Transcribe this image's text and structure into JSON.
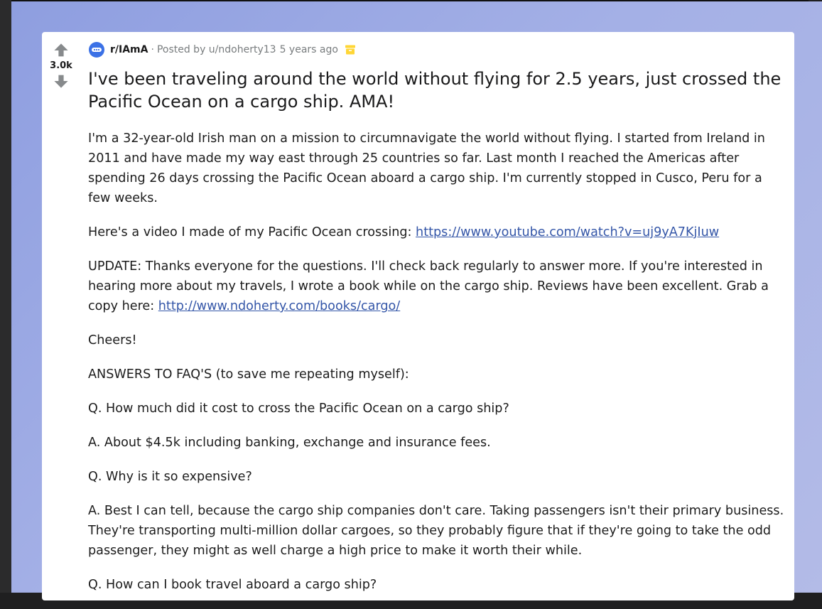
{
  "post": {
    "vote_count": "3.0k",
    "subreddit": "r/IAmA",
    "separator": "·",
    "posted_by": "Posted by u/ndoherty13",
    "age": "5 years ago",
    "title": "I've been traveling around the world without flying for 2.5 years, just crossed the Pacific Ocean on a cargo ship. AMA!",
    "intro": "I'm a 32-year-old Irish man on a mission to circumnavigate the world without flying. I started from Ireland in 2011 and have made my way east through 25 countries so far. Last month I reached the Americas after spending 26 days crossing the Pacific Ocean aboard a cargo ship. I'm currently stopped in Cusco, Peru for a few weeks.",
    "video_text": "Here's a video I made of my Pacific Ocean crossing: ",
    "video_link": "https://www.youtube.com/watch?v=uj9yA7KjIuw",
    "update_text": "UPDATE: Thanks everyone for the questions. I'll check back regularly to answer more. If you're interested in hearing more about my travels, I wrote a book while on the cargo ship. Reviews have been excellent. Grab a copy here: ",
    "update_link": "http://www.ndoherty.com/books/cargo/",
    "cheers": "Cheers!",
    "faq_heading": "ANSWERS TO FAQ'S (to save me repeating myself):",
    "q1": "Q. How much did it cost to cross the Pacific Ocean on a cargo ship?",
    "a1": "A. About $4.5k including banking, exchange and insurance fees.",
    "q2": "Q. Why is it so expensive?",
    "a2": "A. Best I can tell, because the cargo ship companies don't care. Taking passengers isn't their primary business. They're transporting multi-million dollar cargoes, so they probably figure that if they're going to take the odd passenger, they might as well charge a high price to make it worth their while.",
    "q3": "Q. How can I book travel aboard a cargo ship?"
  },
  "icons": {
    "upvote": "upvote-arrow-icon",
    "downvote": "downvote-arrow-icon",
    "subreddit": "subreddit-icon",
    "archived": "archive-box-icon"
  },
  "colors": {
    "subreddit_icon": "#3b71e6",
    "archive_icon": "#ffd635",
    "link": "#3456a8",
    "vote_arrow": "#878a8c"
  }
}
